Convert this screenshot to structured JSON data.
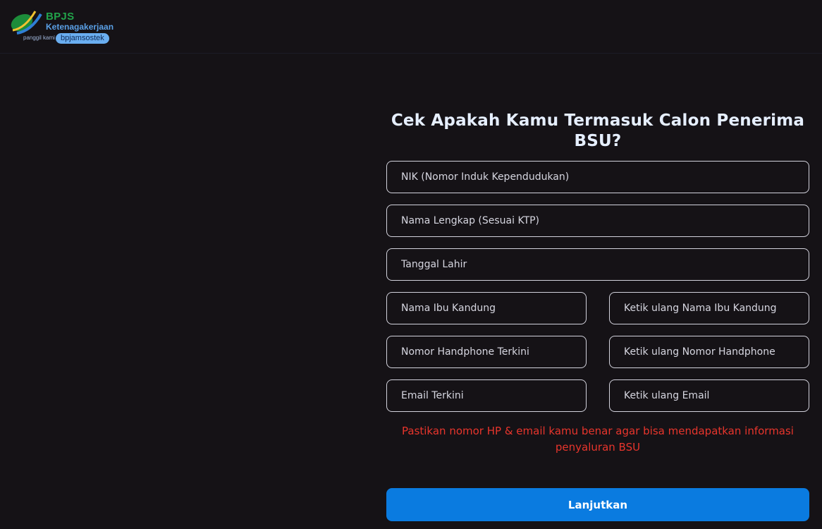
{
  "header": {
    "logo": {
      "brand": "BPJS",
      "subtitle": "Ketenagakerjaan",
      "tagline": "panggil kami",
      "pill": "bpjamsostek"
    }
  },
  "form": {
    "title": "Cek Apakah Kamu Termasuk Calon Penerima BSU?",
    "fields": {
      "nik": {
        "placeholder": "NIK (Nomor Induk Kependudukan)",
        "value": ""
      },
      "nama": {
        "placeholder": "Nama Lengkap (Sesuai KTP)",
        "value": ""
      },
      "tanggal_lahir": {
        "placeholder": "Tanggal Lahir",
        "value": ""
      },
      "ibu": {
        "placeholder": "Nama Ibu Kandung",
        "value": ""
      },
      "ibu_confirm": {
        "placeholder": "Ketik ulang Nama Ibu Kandung",
        "value": ""
      },
      "hp": {
        "placeholder": "Nomor Handphone Terkini",
        "value": ""
      },
      "hp_confirm": {
        "placeholder": "Ketik ulang Nomor Handphone",
        "value": ""
      },
      "email": {
        "placeholder": "Email Terkini",
        "value": ""
      },
      "email_confirm": {
        "placeholder": "Ketik ulang Email",
        "value": ""
      }
    },
    "notice": "Pastikan nomor HP & email kamu benar agar bisa mendapatkan informasi penyaluran BSU",
    "submit_label": "Lanjutkan"
  },
  "colors": {
    "background": "#151216",
    "accent": "#0a7be0",
    "warning": "#e8352c",
    "brand_green": "#22a34a"
  },
  "icons": {
    "logo_mark": "bpjs-logo-icon"
  }
}
